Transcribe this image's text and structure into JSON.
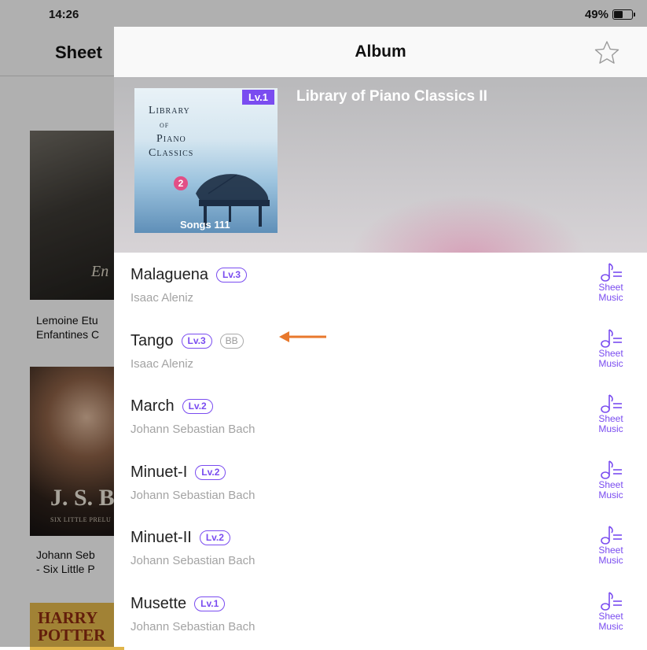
{
  "status": {
    "time": "14:26",
    "battery": "49%"
  },
  "background_app": {
    "title": "Sheet",
    "items": [
      {
        "cover_text": "En",
        "caption_lines": [
          "Lemoine Etu",
          "Enfantines C"
        ]
      },
      {
        "cover_text": "J. S. B",
        "cover_subtext": "SIX LITTLE PRELU",
        "caption_lines": [
          "Johann Seb",
          "- Six Little P"
        ]
      },
      {
        "cover_text_lines": [
          "HARRY",
          "POTTER"
        ]
      }
    ]
  },
  "album": {
    "header_title": "Album",
    "name": "Library of Piano Classics II",
    "cover": {
      "title_lines": [
        "Library",
        "of",
        "Piano",
        "Classics"
      ],
      "number": "2",
      "level": "Lv.1",
      "songs": "Songs 111"
    },
    "sheet_label_line1": "Sheet",
    "sheet_label_line2": "Music",
    "songs": [
      {
        "title": "Malaguena",
        "level": "Lv.3",
        "artist": "Isaac Aleniz"
      },
      {
        "title": "Tango",
        "level": "Lv.3",
        "tag": "BB",
        "artist": "Isaac Aleniz"
      },
      {
        "title": "March",
        "level": "Lv.2",
        "artist": "Johann Sebastian Bach"
      },
      {
        "title": "Minuet-I",
        "level": "Lv.2",
        "artist": "Johann Sebastian Bach"
      },
      {
        "title": "Minuet-II",
        "level": "Lv.2",
        "artist": "Johann Sebastian Bach"
      },
      {
        "title": "Musette",
        "level": "Lv.1",
        "artist": "Johann Sebastian Bach"
      }
    ]
  },
  "colors": {
    "accent": "#7a4cf0",
    "annotation_arrow": "#e8782c",
    "cover_number": "#e24f86"
  }
}
